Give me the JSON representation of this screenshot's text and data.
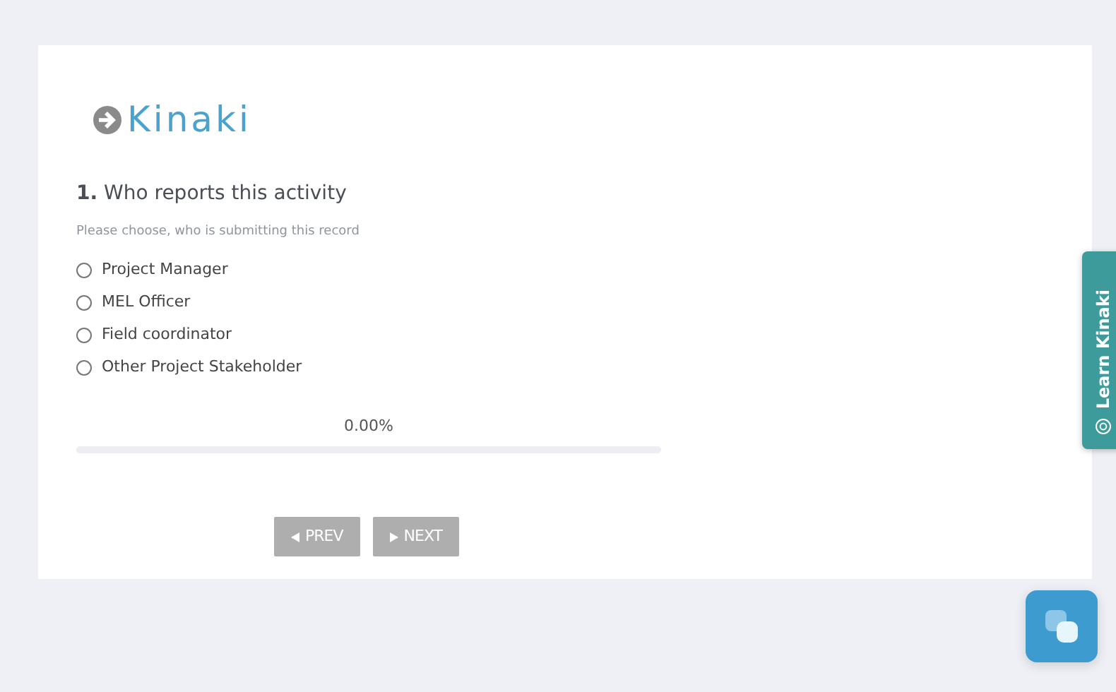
{
  "logo": {
    "text": "Kinaki"
  },
  "question": {
    "number": "1.",
    "title": "Who reports this activity",
    "hint": "Please choose, who is submitting this record",
    "options": [
      {
        "label": "Project Manager",
        "selected": false
      },
      {
        "label": "MEL Officer",
        "selected": false
      },
      {
        "label": "Field coordinator",
        "selected": false
      },
      {
        "label": "Other Project Stakeholder",
        "selected": false
      }
    ]
  },
  "progress": {
    "reading": "0.00%",
    "level": 0
  },
  "buttons": [
    {
      "kind": "prev",
      "label": "PREV",
      "disabled": true
    },
    {
      "kind": "next",
      "label": "NEXT",
      "disabled": true
    }
  ],
  "side_tab": {
    "label": "Learn Kinaki"
  }
}
